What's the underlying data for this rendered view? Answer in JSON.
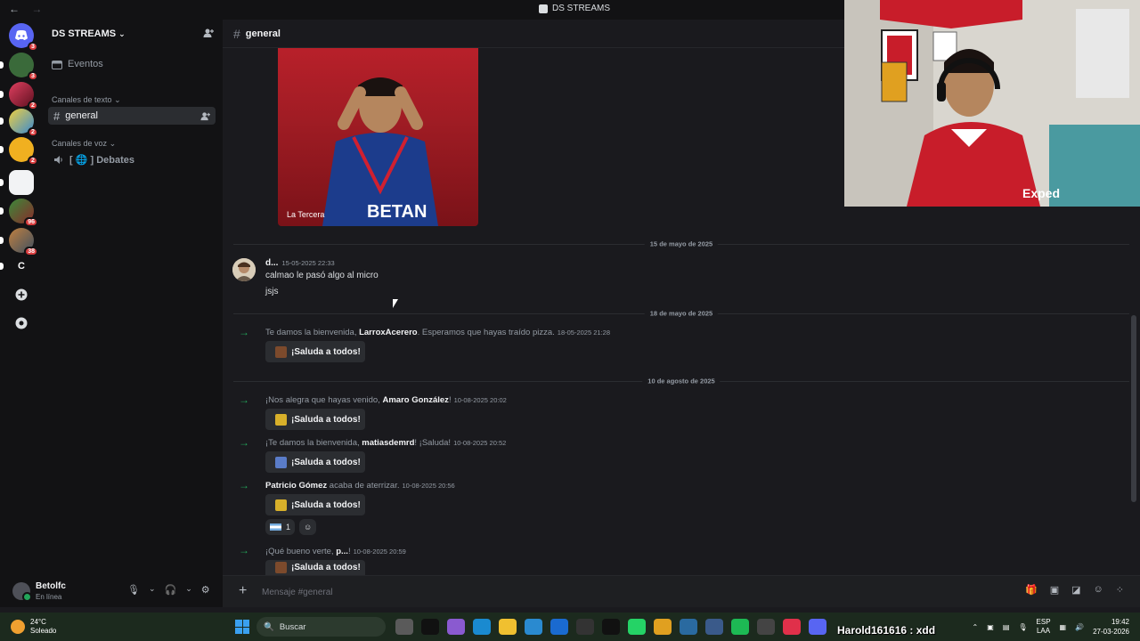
{
  "window": {
    "title": "DS STREAMS",
    "back": "←",
    "forward": "→"
  },
  "guilds": [
    {
      "name": "discord-home",
      "badge": "3",
      "color": "#5865f2"
    },
    {
      "name": "server-green",
      "badge": "3",
      "color": "#3a6a3a"
    },
    {
      "name": "server-pink",
      "badge": "2",
      "color": "#a0304a"
    },
    {
      "name": "server-simpson",
      "badge": "2",
      "color": "#d8b040"
    },
    {
      "name": "server-yellow",
      "badge": "2",
      "color": "#f0b020"
    },
    {
      "name": "server-white",
      "badge": "",
      "color": "#f2f3f5"
    },
    {
      "name": "server-spiderman",
      "badge": "96",
      "color": "#3a5a3a"
    },
    {
      "name": "server-colorful",
      "badge": "38",
      "color": "#8a6a4a"
    },
    {
      "name": "server-c",
      "badge": "",
      "label": "C",
      "color": "#121214"
    }
  ],
  "sidebar": {
    "server_name": "DS STREAMS",
    "events": "Eventos",
    "text_category": "Canales de texto",
    "voice_category": "Canales de voz",
    "channels": [
      {
        "name": "general",
        "type": "text"
      }
    ],
    "voice_channels": [
      {
        "name": "[ 🌐 ] Debates"
      }
    ]
  },
  "user": {
    "name": "Betolfc",
    "status": "En línea"
  },
  "channel": {
    "name": "general"
  },
  "embed": {
    "caption": "La Tercera"
  },
  "dividers": [
    {
      "label": "15 de mayo de 2025"
    },
    {
      "label": "18 de mayo de 2025"
    },
    {
      "label": "10 de agosto de 2025"
    }
  ],
  "messages": [
    {
      "author": "d...",
      "time": "15-05-2025 22:33",
      "lines": [
        "calmao le pasó algo al micro",
        "jsjs"
      ]
    }
  ],
  "system_messages": [
    {
      "pre": "Te damos la bienvenida, ",
      "user": "LarroxAcerero",
      "post": ". Esperamos que hayas traído pizza.",
      "time": "18-05-2025 21:28",
      "button": "¡Saluda a todos!"
    },
    {
      "pre": "¡Nos alegra que hayas venido, ",
      "user": "Amaro González",
      "post": "!",
      "time": "10-08-2025 20:02",
      "button": "¡Saluda a todos!"
    },
    {
      "pre": "¡Te damos la bienvenida, ",
      "user": "matiasdemrd",
      "post": "! ¡Saluda!",
      "time": "10-08-2025 20:52",
      "button": "¡Saluda a todos!"
    },
    {
      "pre": "",
      "user": "Patricio Gómez",
      "post": " acaba de aterrizar.",
      "time": "10-08-2025 20:56",
      "button": "¡Saluda a todos!"
    },
    {
      "pre": "¡Qué bueno verte, ",
      "user": "p...",
      "post": "!",
      "time": "10-08-2025 20:59",
      "button": "¡Saluda a todos!"
    }
  ],
  "reactions": [
    {
      "count": "1"
    }
  ],
  "composer": {
    "placeholder": "Mensaje #general"
  },
  "taskbar": {
    "temperature": "24°C",
    "weather": "Soleado",
    "search": "Buscar",
    "overlay_text": "Harold161616 : xdd",
    "lang_top": "ESP",
    "lang_bottom": "LAA",
    "time": "19:42",
    "date": "27-03-2026"
  }
}
